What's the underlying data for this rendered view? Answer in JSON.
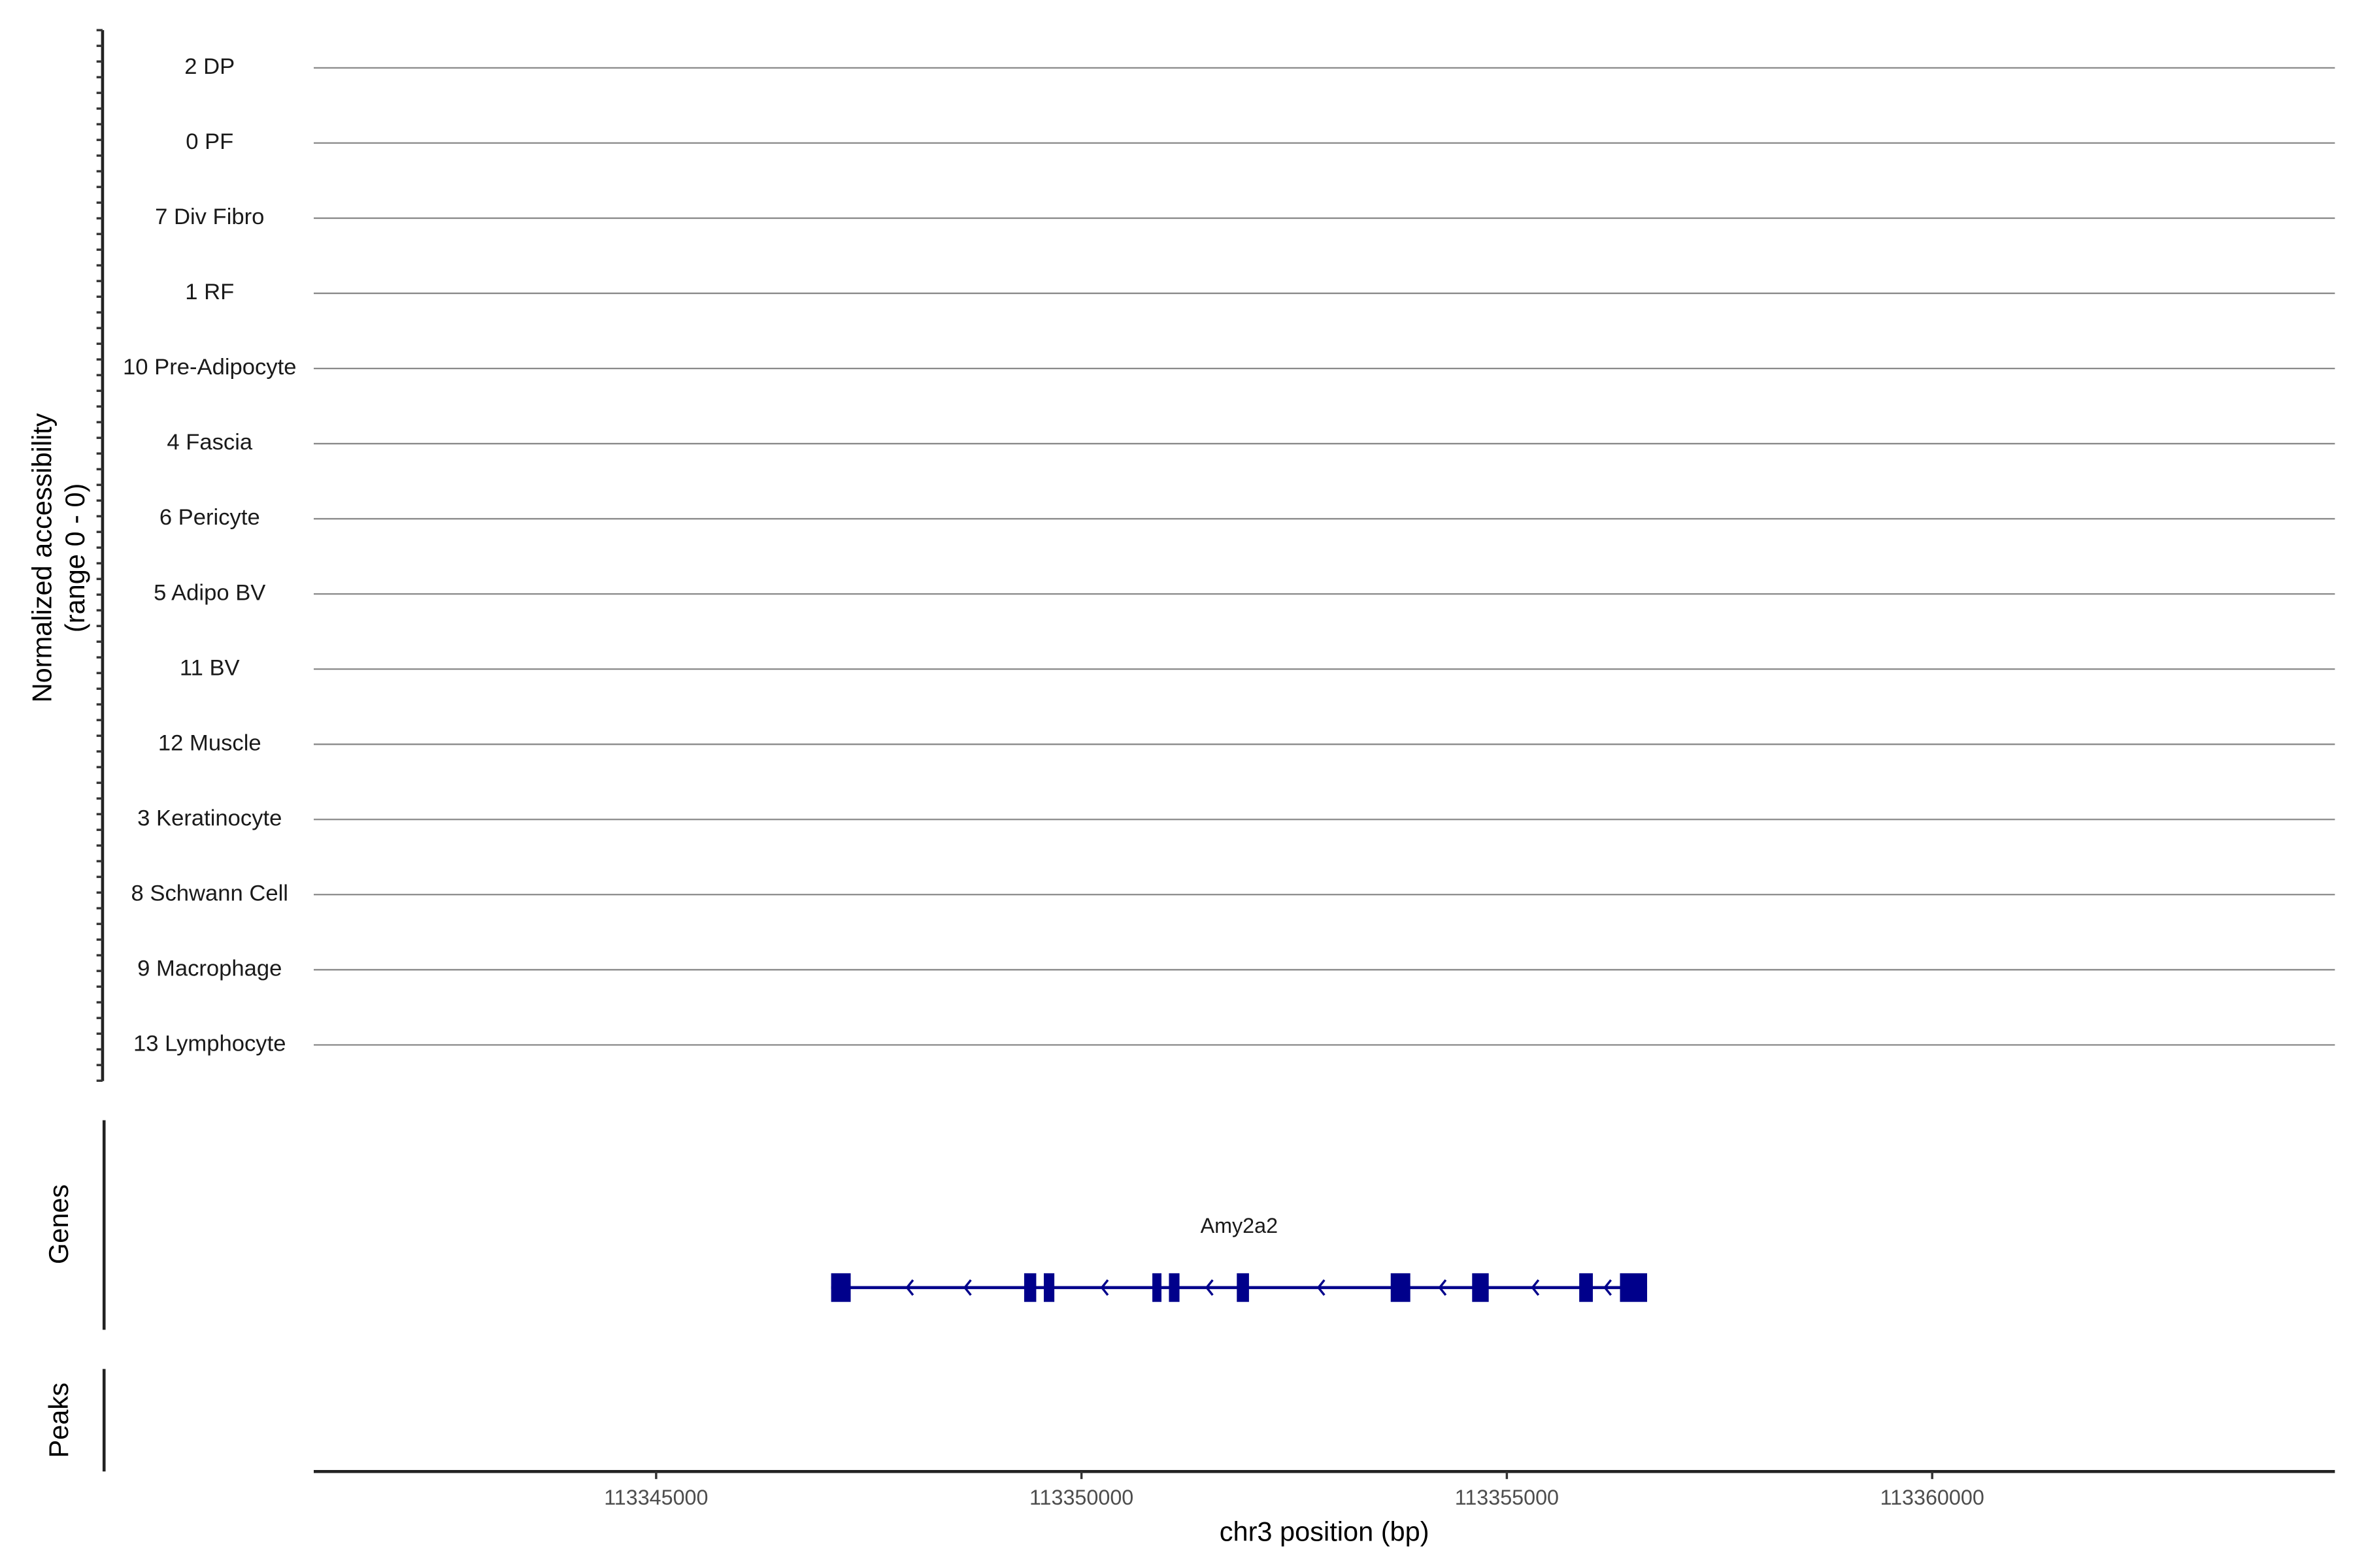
{
  "chart_data": {
    "type": "genome-track",
    "coverage": {
      "ylabel_line1": "Normalized accessibility",
      "ylabel_line2": "(range 0 - 0)",
      "range": [
        0,
        0
      ],
      "groups": [
        "2 DP",
        "0 PF",
        "7 Div Fibro",
        "1 RF",
        "10 Pre-Adipocyte",
        "4 Fascia",
        "6 Pericyte",
        "5 Adipo BV",
        "11 BV",
        "12 Muscle",
        "3 Keratinocyte",
        "8 Schwann Cell",
        "9 Macrophage",
        "13 Lymphocyte"
      ]
    },
    "genes": {
      "label": "Genes",
      "gene_name": "Amy2a2",
      "strand": "-",
      "color": "#00008B",
      "exons": [
        [
          113347057,
          113347287
        ],
        [
          113349326,
          113349468
        ],
        [
          113349557,
          113349681
        ],
        [
          113350833,
          113350940
        ],
        [
          113351028,
          113351152
        ],
        [
          113351826,
          113351969
        ],
        [
          113353635,
          113353865
        ],
        [
          113354592,
          113354787
        ],
        [
          113355851,
          113356011
        ],
        [
          113356330,
          113356649
        ]
      ]
    },
    "peaks": {
      "label": "Peaks",
      "regions": []
    },
    "xaxis": {
      "label": "chr3 position (bp)",
      "xlim": [
        113340975,
        113364734
      ],
      "ticks": [
        113345000,
        113350000,
        113355000,
        113360000
      ],
      "tick_labels": [
        "113345000",
        "113350000",
        "113355000",
        "113360000"
      ]
    }
  }
}
